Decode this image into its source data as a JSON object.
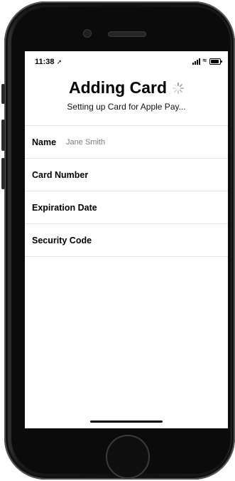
{
  "status_bar": {
    "time": "11:38",
    "location_arrow": "➚",
    "wifi": "≈"
  },
  "header": {
    "title": "Adding Card",
    "subtitle": "Setting up Card for Apple Pay..."
  },
  "form": {
    "rows": [
      {
        "label": "Name",
        "value": "Jane Smith"
      },
      {
        "label": "Card Number",
        "value": ""
      },
      {
        "label": "Expiration Date",
        "value": ""
      },
      {
        "label": "Security Code",
        "value": ""
      }
    ]
  },
  "icons": {
    "signal": "signal-icon",
    "wifi": "wifi-icon",
    "battery": "battery-icon",
    "spinner": "spinner-icon",
    "location": "location-arrow-icon"
  },
  "colors": {
    "phone_body": "#111111",
    "screen_bg": "#ffffff",
    "separator": "#e3e3e3",
    "value_text": "#7a7a7a"
  }
}
